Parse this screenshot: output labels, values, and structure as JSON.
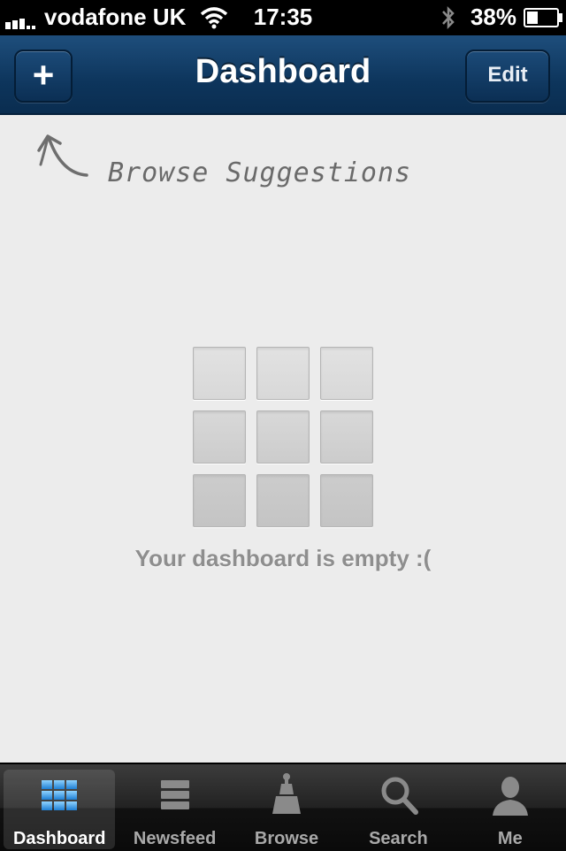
{
  "status_bar": {
    "carrier": "vodafone UK",
    "time": "17:35",
    "battery_percent": "38%",
    "battery_level": 0.38,
    "icons": [
      "signal-icon",
      "wifi-icon",
      "bluetooth-icon",
      "battery-icon"
    ]
  },
  "nav": {
    "title": "Dashboard",
    "add_label": "+",
    "edit_label": "Edit"
  },
  "hint": {
    "text": "Browse Suggestions"
  },
  "empty_state": {
    "message": "Your dashboard is empty :("
  },
  "tabs": [
    {
      "label": "Dashboard",
      "icon": "dashboard-grid-icon",
      "active": true
    },
    {
      "label": "Newsfeed",
      "icon": "newsfeed-list-icon",
      "active": false
    },
    {
      "label": "Browse",
      "icon": "browse-tower-icon",
      "active": false
    },
    {
      "label": "Search",
      "icon": "search-icon",
      "active": false
    },
    {
      "label": "Me",
      "icon": "person-icon",
      "active": false
    }
  ],
  "colors": {
    "nav_blue": "#0d355c",
    "background": "#ececec",
    "active_tab_blue": "#3aa0e8"
  }
}
